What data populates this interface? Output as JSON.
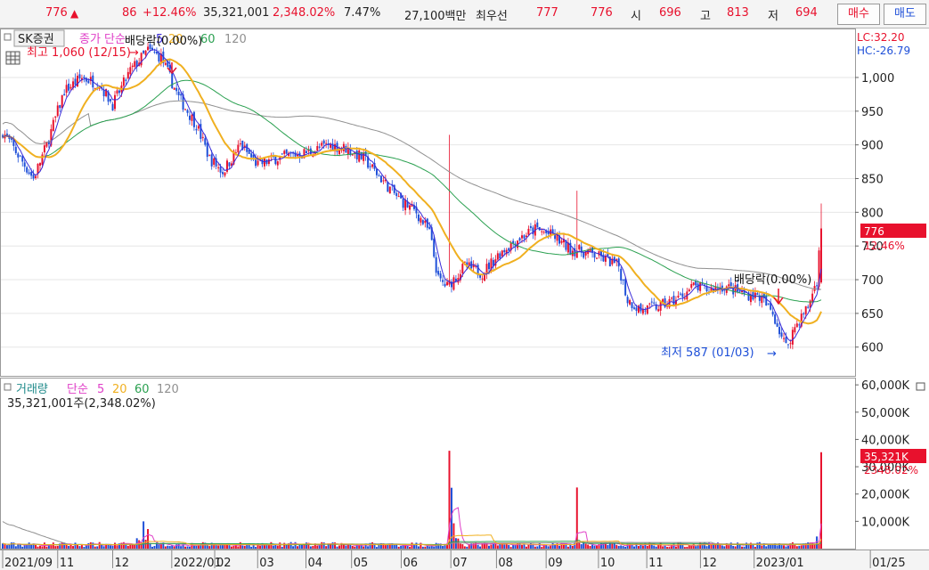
{
  "quote": {
    "price": "776",
    "arrow": "▲",
    "change": "86",
    "change_pct": "+12.46%",
    "volume": "35,321,001",
    "volume_ratio": "2,348.02%",
    "turnover": "7.47%",
    "amount": "27,100백만",
    "bid_label": "최우선",
    "ask_price": "777",
    "bid_price": "776",
    "open_label": "시",
    "open": "696",
    "high_label": "고",
    "high": "813",
    "low_label": "저",
    "low": "694",
    "buy_label": "매수",
    "sell_label": "매도"
  },
  "price_panel": {
    "stock_name": "SK증권",
    "ma_label": "종가 단순",
    "ma_periods": [
      "5",
      "20",
      "60",
      "120"
    ],
    "dividend_top": "배당락(0.00%)",
    "dividend_right": "배당락(0.00%)",
    "high_annot": "최고 1,060 (12/15)",
    "low_annot": "최저 587 (01/03)",
    "lc": "LC:32.20",
    "hc": "HC:-26.79",
    "current_price": "776",
    "current_pct": "12.46%"
  },
  "volume_panel": {
    "title": "거래량",
    "ma_label": "단순",
    "ma_periods": [
      "5",
      "20",
      "60",
      "120"
    ],
    "current_line": "35,321,001주(2,348.02%)",
    "current_value": "35,321K",
    "current_pct": "2348.02%"
  },
  "colors": {
    "up": "#e8112d",
    "down": "#1e4fd8",
    "ma5": "#3a2bd9",
    "ma20": "#f0b020",
    "ma60": "#2aa050",
    "ma120": "#909090",
    "vol_ma5": "#e040c8"
  },
  "chart_data": {
    "type": "candlestick",
    "price_axis": {
      "min": 560,
      "max": 1070,
      "ticks": [
        600,
        650,
        700,
        750,
        800,
        850,
        900,
        950,
        1000
      ]
    },
    "volume_axis": {
      "min": 0,
      "max": 62000,
      "ticks": [
        "10,000K",
        "20,000K",
        "30,000K",
        "40,000K",
        "50,000K",
        "60,000K"
      ]
    },
    "x_ticks": [
      "2021/09",
      "11",
      "12",
      "2022/01",
      "02",
      "03",
      "04",
      "05",
      "06",
      "07",
      "08",
      "09",
      "10",
      "11",
      "12",
      "2023/01",
      "01/25"
    ],
    "price_keypoints": [
      [
        0,
        920
      ],
      [
        8,
        880
      ],
      [
        14,
        850
      ],
      [
        20,
        900
      ],
      [
        28,
        980
      ],
      [
        36,
        1000
      ],
      [
        44,
        990
      ],
      [
        50,
        960
      ],
      [
        58,
        1010
      ],
      [
        66,
        1040
      ],
      [
        72,
        1030
      ],
      [
        80,
        970
      ],
      [
        88,
        930
      ],
      [
        94,
        880
      ],
      [
        100,
        860
      ],
      [
        108,
        900
      ],
      [
        116,
        870
      ],
      [
        124,
        880
      ],
      [
        132,
        885
      ],
      [
        140,
        890
      ],
      [
        148,
        900
      ],
      [
        156,
        895
      ],
      [
        164,
        880
      ],
      [
        172,
        850
      ],
      [
        180,
        820
      ],
      [
        188,
        800
      ],
      [
        194,
        770
      ],
      [
        198,
        700
      ],
      [
        202,
        690
      ],
      [
        210,
        720
      ],
      [
        218,
        710
      ],
      [
        226,
        740
      ],
      [
        234,
        760
      ],
      [
        242,
        775
      ],
      [
        250,
        765
      ],
      [
        258,
        745
      ],
      [
        266,
        740
      ],
      [
        274,
        730
      ],
      [
        280,
        720
      ],
      [
        284,
        670
      ],
      [
        290,
        655
      ],
      [
        298,
        660
      ],
      [
        306,
        670
      ],
      [
        314,
        690
      ],
      [
        320,
        685
      ],
      [
        328,
        690
      ],
      [
        336,
        680
      ],
      [
        344,
        675
      ],
      [
        350,
        650
      ],
      [
        356,
        600
      ],
      [
        360,
        630
      ],
      [
        366,
        660
      ],
      [
        370,
        700
      ],
      [
        372,
        776
      ]
    ],
    "volume_keypoints": [
      [
        0,
        1500
      ],
      [
        60,
        1500
      ],
      [
        66,
        9000
      ],
      [
        67,
        1500
      ],
      [
        202,
        1500
      ],
      [
        203,
        58000
      ],
      [
        204,
        20000
      ],
      [
        205,
        6000
      ],
      [
        206,
        2500
      ],
      [
        212,
        1500
      ],
      [
        260,
        1500
      ],
      [
        261,
        17500
      ],
      [
        262,
        2000
      ],
      [
        265,
        1500
      ],
      [
        369,
        1500
      ],
      [
        370,
        3500
      ],
      [
        371,
        5000
      ],
      [
        372,
        35300
      ]
    ]
  }
}
